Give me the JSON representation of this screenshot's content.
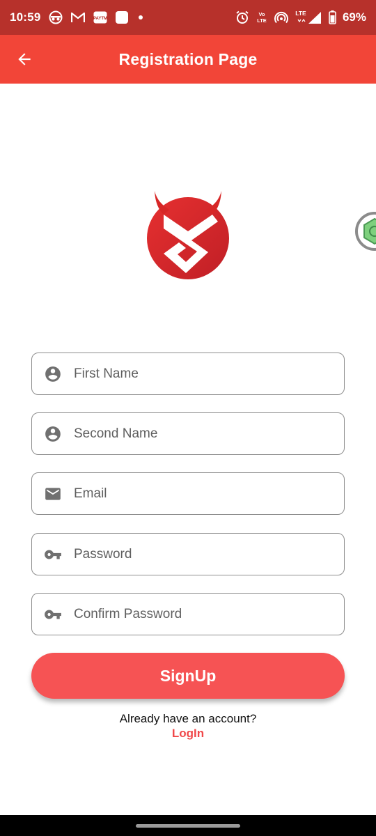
{
  "status_bar": {
    "time": "10:59",
    "battery": "69%",
    "left_icons": [
      "incognito-icon",
      "gmail-icon",
      "paytm-icon",
      "square-notification-icon",
      "dot-icon"
    ],
    "right_icons": [
      "alarm-icon",
      "volte-icon",
      "hotspot-icon",
      "lte-signal-icon",
      "battery-icon"
    ],
    "network_label": "LTE"
  },
  "app_bar": {
    "title": "Registration Page",
    "back_icon": "arrow-left-icon"
  },
  "form": {
    "first_name": {
      "placeholder": "First Name",
      "value": "",
      "icon": "account-circle-icon"
    },
    "second_name": {
      "placeholder": "Second Name",
      "value": "",
      "icon": "account-circle-icon"
    },
    "email": {
      "placeholder": "Email",
      "value": "",
      "icon": "mail-icon"
    },
    "password": {
      "placeholder": "Password",
      "value": "",
      "icon": "key-icon"
    },
    "confirm_password": {
      "placeholder": "Confirm Password",
      "value": "",
      "icon": "key-icon"
    }
  },
  "signup_button": {
    "label": "SignUp"
  },
  "footer": {
    "prompt": "Already have an account?",
    "login_label": "LogIn"
  },
  "colors": {
    "status_bar": "#b7312b",
    "app_bar": "#f24538",
    "button": "#f65354",
    "link": "#f0484a",
    "logo_red": "#d72727"
  }
}
